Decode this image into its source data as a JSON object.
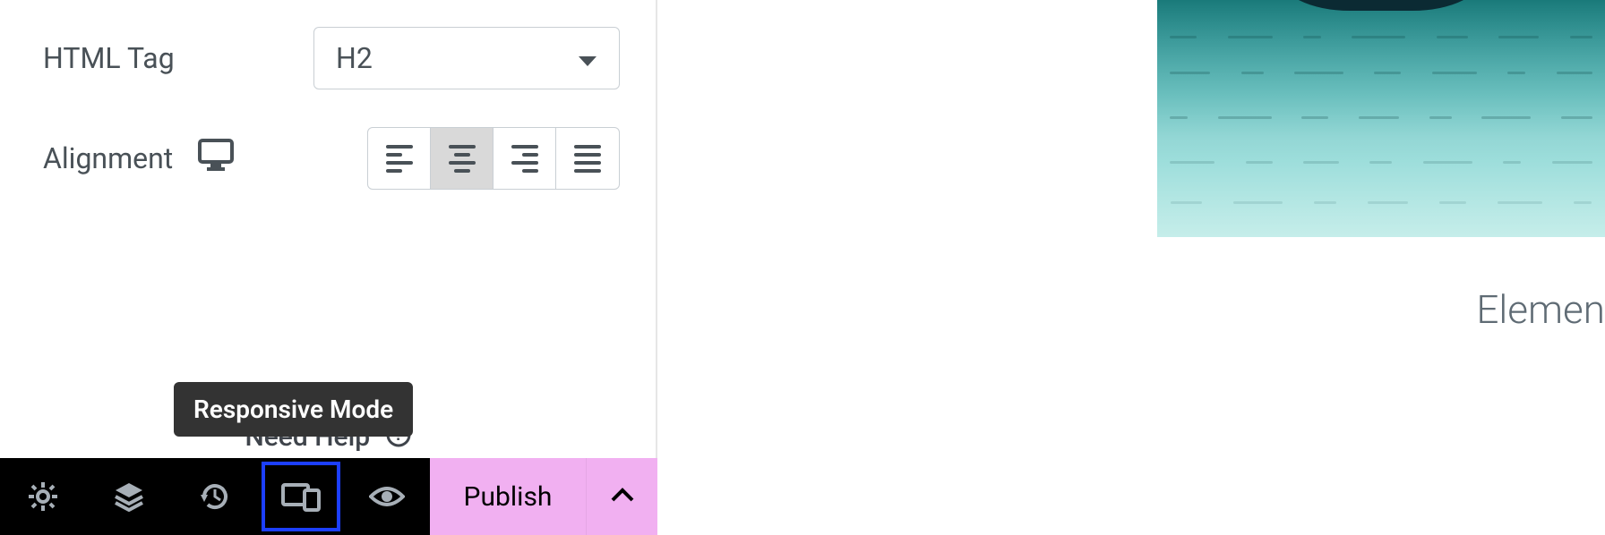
{
  "controls": {
    "html_tag": {
      "label": "HTML Tag",
      "value": "H2"
    },
    "alignment": {
      "label": "Alignment",
      "options": [
        "left",
        "center",
        "right",
        "justify"
      ],
      "selected": "center"
    }
  },
  "help": {
    "text": "Need Help"
  },
  "tooltip": {
    "responsive_mode": "Responsive Mode"
  },
  "footer": {
    "publish_label": "Publish",
    "tools": [
      "settings",
      "navigator",
      "history",
      "responsive",
      "preview"
    ]
  },
  "preview": {
    "caption": "Elemen"
  }
}
